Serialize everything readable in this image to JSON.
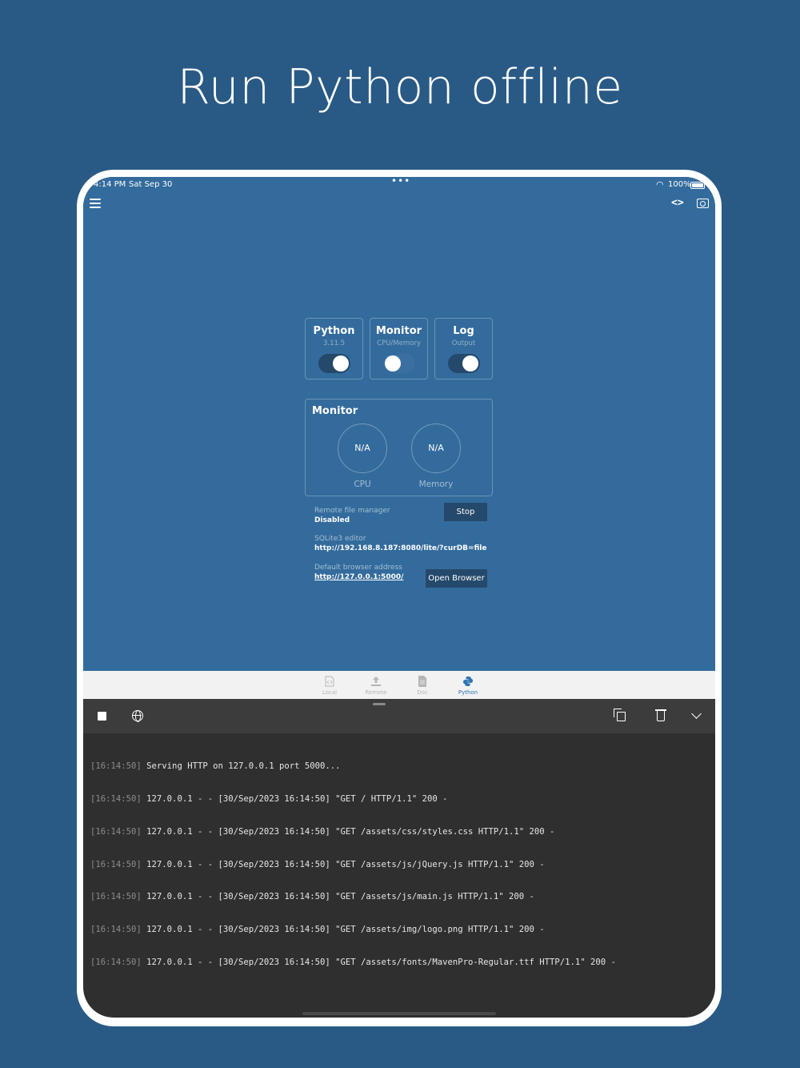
{
  "headline": "Run Python offline",
  "status_bar": {
    "time": "4:14 PM",
    "date": "Sat Sep 30",
    "dots": "•••",
    "battery": "100%"
  },
  "toolbar": {
    "menu_icon": "hamburger-menu-icon",
    "code_icon_glyph": "<>",
    "screen_icon": "display-icon"
  },
  "tiles": [
    {
      "title": "Python",
      "subtitle": "3.11.5",
      "toggle": "on"
    },
    {
      "title": "Monitor",
      "subtitle": "CPU/Memory",
      "toggle": "off"
    },
    {
      "title": "Log",
      "subtitle": "Output",
      "toggle": "on"
    }
  ],
  "monitor": {
    "title": "Monitor",
    "cpu_value": "N/A",
    "cpu_label": "CPU",
    "memory_value": "N/A",
    "memory_label": "Memory"
  },
  "remote": {
    "label": "Remote file manager",
    "value": "Disabled",
    "button": "Stop"
  },
  "sqlite": {
    "label": "SQLite3 editor",
    "value": "http://192.168.8.187:8080/lite/?curDB=file"
  },
  "browser": {
    "label": "Default browser address",
    "value": "http://127.0.0.1:5000/",
    "button": "Open Browser"
  },
  "tabs": [
    {
      "label": "Local",
      "icon": "code-file-icon"
    },
    {
      "label": "Remote",
      "icon": "upload-icon"
    },
    {
      "label": "Doc",
      "icon": "document-icon"
    },
    {
      "label": "Python",
      "icon": "python-icon",
      "active": true
    }
  ],
  "console_toolbar": {
    "stop_icon": "stop-icon",
    "globe_icon": "globe-icon",
    "copy_icon": "copy-icon",
    "trash_icon": "trash-icon",
    "collapse_icon": "chevron-down-icon"
  },
  "log": [
    {
      "ts": "[16:14:50]",
      "msg": "Serving HTTP on 127.0.0.1 port 5000..."
    },
    {
      "ts": "[16:14:50]",
      "msg": "127.0.0.1 - - [30/Sep/2023 16:14:50] \"GET / HTTP/1.1\" 200 -"
    },
    {
      "ts": "[16:14:50]",
      "msg": "127.0.0.1 - - [30/Sep/2023 16:14:50] \"GET /assets/css/styles.css HTTP/1.1\" 200 -"
    },
    {
      "ts": "[16:14:50]",
      "msg": "127.0.0.1 - - [30/Sep/2023 16:14:50] \"GET /assets/js/jQuery.js HTTP/1.1\" 200 -"
    },
    {
      "ts": "[16:14:50]",
      "msg": "127.0.0.1 - - [30/Sep/2023 16:14:50] \"GET /assets/js/main.js HTTP/1.1\" 200 -"
    },
    {
      "ts": "[16:14:50]",
      "msg": "127.0.0.1 - - [30/Sep/2023 16:14:50] \"GET /assets/img/logo.png HTTP/1.1\" 200 -"
    },
    {
      "ts": "[16:14:50]",
      "msg": "127.0.0.1 - - [30/Sep/2023 16:14:50] \"GET /assets/fonts/MavenPro-Regular.ttf HTTP/1.1\" 200 -"
    }
  ],
  "colors": {
    "page_bg": "#295a85",
    "app_bg": "#336b9c",
    "console_bg": "#2f2f2f",
    "accent": "#2f73b4"
  }
}
